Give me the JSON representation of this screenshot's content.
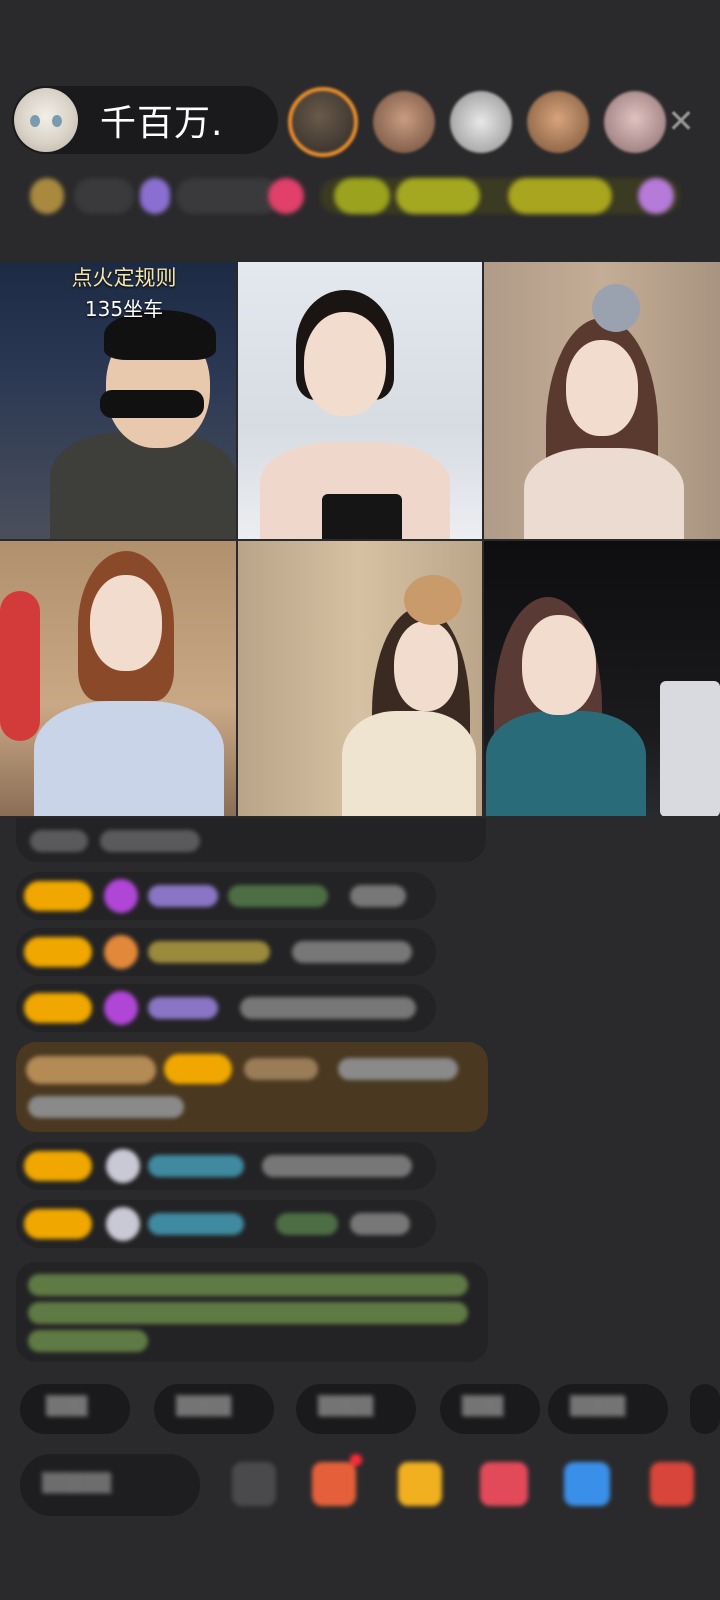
{
  "header": {
    "host_name": "千百万.",
    "viewer_avatar_count": 5,
    "close_icon": "close-icon"
  },
  "grid": {
    "tiles": [
      {
        "rule_title": "点火定规则",
        "seat_label": "135坐车"
      },
      {},
      {},
      {},
      {},
      {}
    ]
  },
  "colors": {
    "background": "#2a2a2c",
    "badge": "#f0a800",
    "viewer_ring": "#e88c2a",
    "rule_text": "#f6e6a7"
  }
}
